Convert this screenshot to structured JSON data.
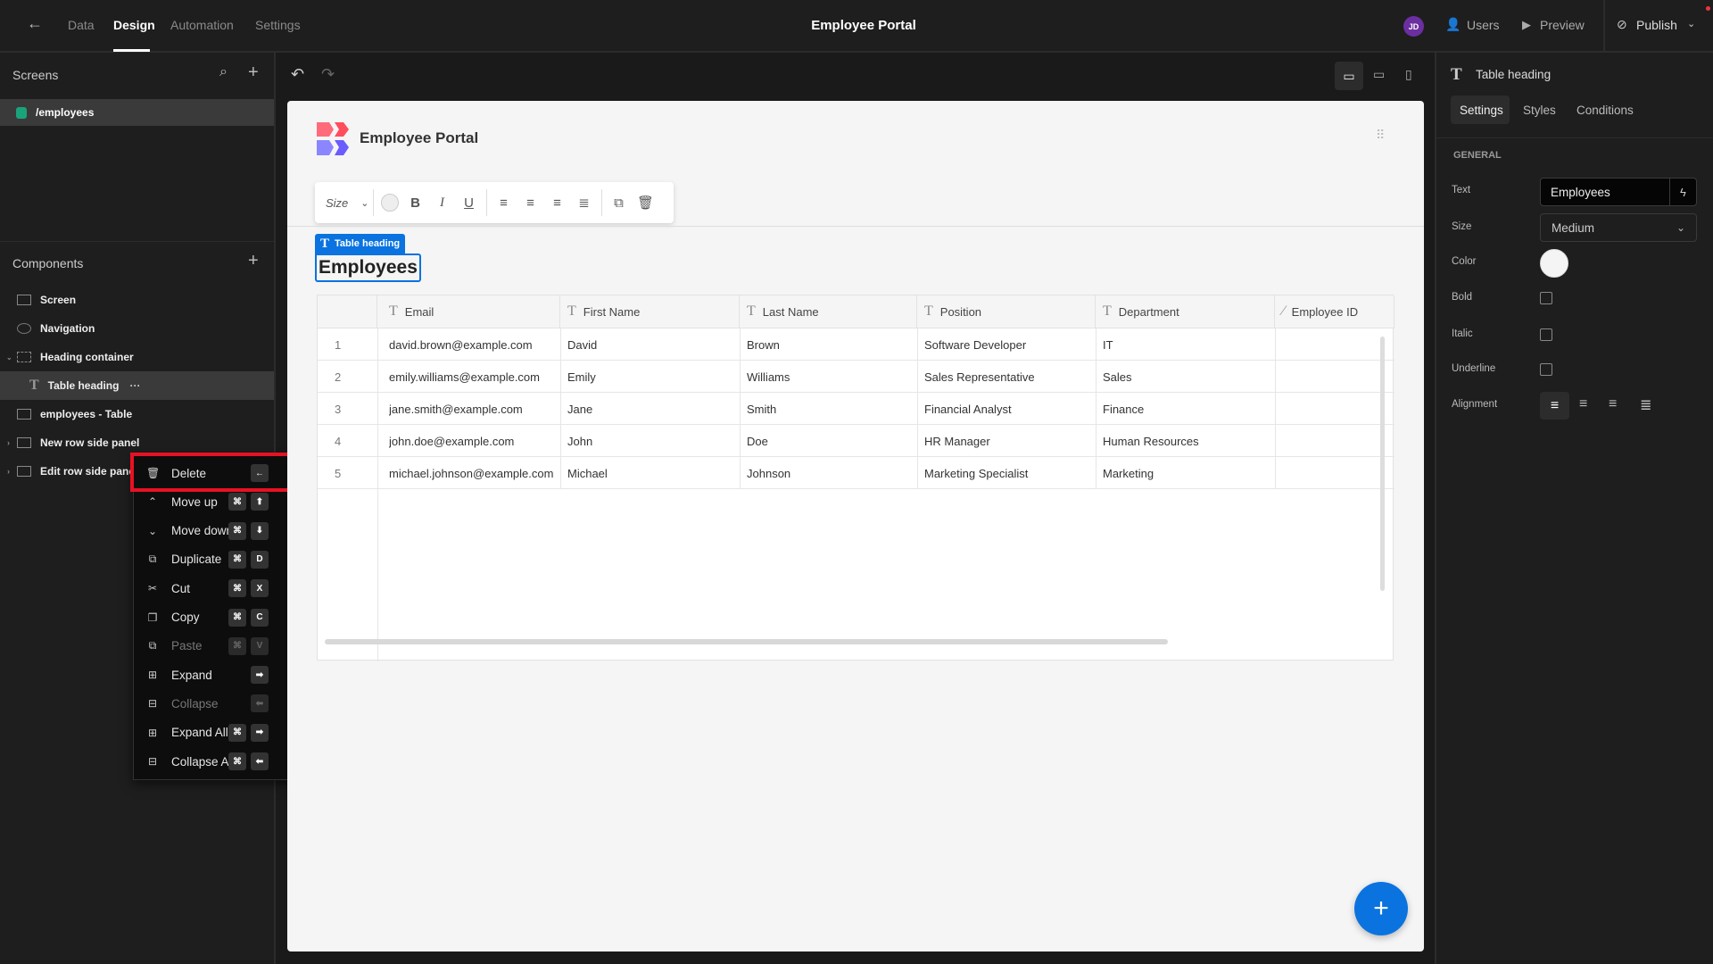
{
  "topbar": {
    "nav": [
      "Data",
      "Design",
      "Automation",
      "Settings"
    ],
    "active": "Design",
    "title": "Employee Portal",
    "avatar": "JD",
    "users": "Users",
    "preview": "Preview",
    "publish": "Publish"
  },
  "screens": {
    "title": "Screens",
    "items": [
      "/employees"
    ],
    "color": "#1aa37a"
  },
  "components": {
    "title": "Components",
    "items": [
      "Screen",
      "Navigation",
      "Heading container",
      "Table heading",
      "employees - Table",
      "New row side panel",
      "Edit row side panel"
    ]
  },
  "menu": {
    "items": [
      {
        "label": "Delete",
        "icon": "trash-icon",
        "keys": [
          "←"
        ],
        "disabled": false
      },
      {
        "label": "Move up",
        "icon": "chevron-up-icon",
        "keys": [
          "⌘",
          "⬆"
        ],
        "disabled": false
      },
      {
        "label": "Move down",
        "icon": "chevron-down-icon",
        "keys": [
          "⌘",
          "⬇"
        ],
        "disabled": false
      },
      {
        "label": "Duplicate",
        "icon": "duplicate-icon",
        "keys": [
          "⌘",
          "D"
        ],
        "disabled": false
      },
      {
        "label": "Cut",
        "icon": "scissors-icon",
        "keys": [
          "⌘",
          "X"
        ],
        "disabled": false
      },
      {
        "label": "Copy",
        "icon": "copy-icon",
        "keys": [
          "⌘",
          "C"
        ],
        "disabled": false
      },
      {
        "label": "Paste",
        "icon": "paste-icon",
        "keys": [
          "⌘",
          "V"
        ],
        "disabled": true
      },
      {
        "label": "Expand",
        "icon": "plus-square-icon",
        "keys": [
          "➡"
        ],
        "disabled": false
      },
      {
        "label": "Collapse",
        "icon": "minus-square-icon",
        "keys": [
          "⬅"
        ],
        "disabled": true
      },
      {
        "label": "Expand All",
        "icon": "expand-all-icon",
        "keys": [
          "⌘",
          "➡"
        ],
        "disabled": false
      },
      {
        "label": "Collapse All",
        "icon": "collapse-all-icon",
        "keys": [
          "⌘",
          "⬅"
        ],
        "disabled": false
      }
    ]
  },
  "canvas": {
    "app_title": "Employee Portal",
    "toolbar_size": "Size",
    "tag": "Table heading",
    "heading": "Employees",
    "columns": [
      "Email",
      "First Name",
      "Last Name",
      "Position",
      "Department",
      "Employee ID"
    ],
    "rows": [
      [
        "1",
        "david.brown@example.com",
        "David",
        "Brown",
        "Software Developer",
        "IT",
        ""
      ],
      [
        "2",
        "emily.williams@example.com",
        "Emily",
        "Williams",
        "Sales Representative",
        "Sales",
        ""
      ],
      [
        "3",
        "jane.smith@example.com",
        "Jane",
        "Smith",
        "Financial Analyst",
        "Finance",
        ""
      ],
      [
        "4",
        "john.doe@example.com",
        "John",
        "Doe",
        "HR Manager",
        "Human Resources",
        ""
      ],
      [
        "5",
        "michael.johnson@example.com",
        "Michael",
        "Johnson",
        "Marketing Specialist",
        "Marketing",
        ""
      ]
    ]
  },
  "props": {
    "title": "Table heading",
    "tabs": [
      "Settings",
      "Styles",
      "Conditions"
    ],
    "active_tab": "Settings",
    "section": "GENERAL",
    "labels": [
      "Text",
      "Size",
      "Color",
      "Bold",
      "Italic",
      "Underline",
      "Alignment"
    ],
    "text_value": "Employees",
    "size_value": "Medium",
    "bold": false,
    "italic": false,
    "underline": false,
    "alignment": "left"
  },
  "colors": {
    "accent": "#0a73e0",
    "selection": "#e81123",
    "avatar": "#6b2fa0"
  }
}
